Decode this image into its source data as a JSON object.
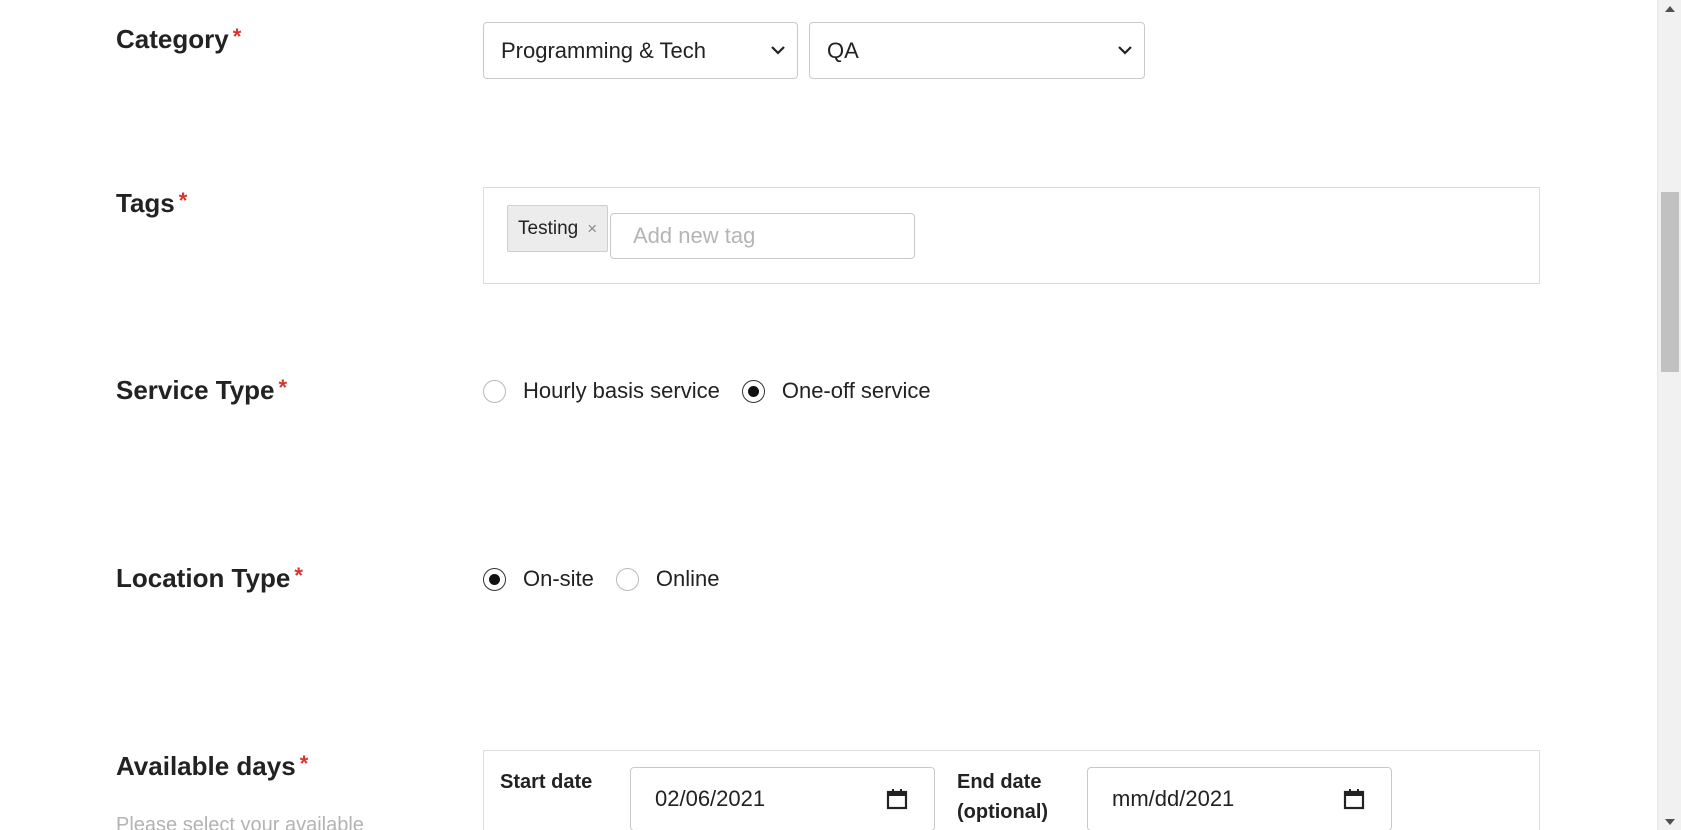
{
  "category": {
    "label": "Category",
    "required_mark": "*",
    "primary_value": "Programming & Tech",
    "secondary_value": "QA"
  },
  "tags": {
    "label": "Tags",
    "required_mark": "*",
    "items": [
      "Testing"
    ],
    "remove_glyph": "×",
    "input_placeholder": "Add new tag"
  },
  "service_type": {
    "label": "Service Type",
    "required_mark": "*",
    "options": [
      {
        "label": "Hourly basis service",
        "selected": false
      },
      {
        "label": "One-off service",
        "selected": true
      }
    ]
  },
  "location_type": {
    "label": "Location Type",
    "required_mark": "*",
    "options": [
      {
        "label": "On-site",
        "selected": true
      },
      {
        "label": "Online",
        "selected": false
      }
    ]
  },
  "available_days": {
    "label": "Available days",
    "required_mark": "*",
    "helper": "Please select your available",
    "start_label": "Start date",
    "start_value": "02/06/2021",
    "end_label_line1": "End date",
    "end_label_line2": "(optional)",
    "end_value": "mm/dd/2021"
  },
  "icons": {
    "select_chevron": "chevron-down-icon",
    "date_picker": "calendar-icon",
    "scroll_up": "scroll-up-arrow-icon",
    "scroll_down": "scroll-down-arrow-icon"
  },
  "colors": {
    "required": "#d9342b",
    "border": "#c9c9c9",
    "tag_bg": "#ececec",
    "placeholder": "#b5b5b5"
  }
}
